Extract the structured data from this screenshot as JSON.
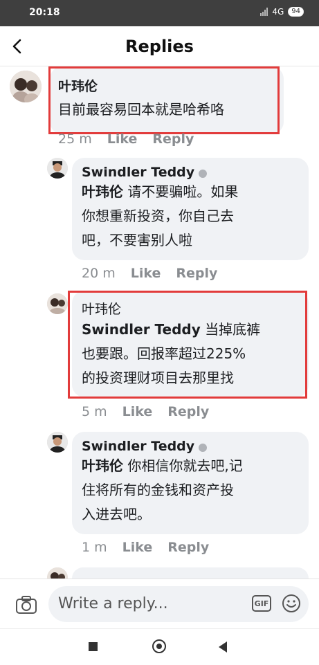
{
  "status_bar": {
    "time": "20:18",
    "network": "4G",
    "battery": "94"
  },
  "header": {
    "title": "Replies"
  },
  "comments": [
    {
      "author": "叶玮伦",
      "text": "目前最容易回本就是哈希咯",
      "time": "25 m",
      "like": "Like",
      "reply": "Reply"
    },
    {
      "author": "Swindler Teddy",
      "mention": "叶玮伦",
      "text_line1": " 请不要骗啦。如果",
      "text_line2": "你想重新投资，你自己去",
      "text_line3": "吧，不要害别人啦",
      "time": "20 m",
      "like": "Like",
      "reply": "Reply"
    },
    {
      "author": "叶玮伦",
      "mention": "Swindler Teddy",
      "text_line1": " 当掉底裤",
      "text_line2": "也要跟。回报率超过225%",
      "text_line3": "的投资理财项目去那里找",
      "time": "5 m",
      "like": "Like",
      "reply": "Reply"
    },
    {
      "author": "Swindler Teddy",
      "mention": "叶玮伦",
      "text_line1": " 你相信你就去吧,记",
      "text_line2": "住将所有的金钱和资产投",
      "text_line3": "入进去吧。",
      "time": "1 m",
      "like": "Like",
      "reply": "Reply"
    }
  ],
  "composer": {
    "placeholder": "Write a reply...",
    "gif": "GIF"
  },
  "colors": {
    "highlight": "#e23b3b",
    "bubble": "#f0f2f5",
    "meta": "#8a8d91"
  }
}
